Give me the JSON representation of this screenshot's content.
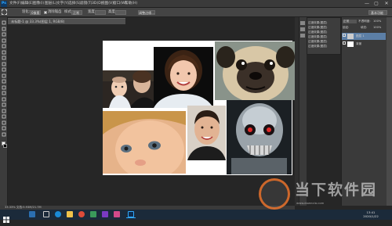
{
  "menubar": {
    "app_icon": "Ps",
    "items": [
      "文件(F)",
      "编辑(E)",
      "图像(I)",
      "图层(L)",
      "文字(Y)",
      "选择(S)",
      "滤镜(T)",
      "3D(D)",
      "视图(V)",
      "窗口(W)",
      "帮助(H)"
    ],
    "window_controls": [
      "—",
      "▢",
      "✕"
    ]
  },
  "options_bar": {
    "feather_label": "羽化:",
    "feather_value": "0像素",
    "anti_alias_label": "消除锯齿",
    "style_label": "样式:",
    "style_value": "正常",
    "width_label": "宽度:",
    "height_label": "高度:",
    "refine_button": "调整边缘...",
    "workspace_select": "基本功能"
  },
  "document": {
    "tab_title": "未标题-1 @ 33.3%(图层 1, RGB/8)",
    "status_text": "33.33%    文档:5.93M/21.7M"
  },
  "actions_panel": {
    "rows": [
      "过渡效果(图层)",
      "过渡效果(图层)",
      "过渡效果(图层)",
      "过渡效果(图层)",
      "过渡效果(图层)",
      "过渡效果(图层)"
    ]
  },
  "layers_panel": {
    "blend_mode": "正常",
    "opacity_label": "不透明度:",
    "opacity_value": "100%",
    "lock_label": "锁定:",
    "fill_label": "填充:",
    "fill_value": "100%",
    "layers": [
      "图层 1",
      "背景"
    ]
  },
  "taskbar": {
    "time": "13:41",
    "date": "2020/1/22"
  },
  "watermark": {
    "title": "当下软件园",
    "subtitle": "www.downxia.com"
  },
  "colors": {
    "menubar_bg": "#3a3a3a",
    "workspace_bg": "#262626",
    "canvas_bg": "#ffffff",
    "taskbar_bg": "#1b2a3a",
    "accent": "#31a8ff"
  },
  "icons": [
    "photoshop-icon",
    "start-icon",
    "search-icon",
    "taskview-icon",
    "edge-icon",
    "explorer-icon",
    "chrome-icon",
    "ps-taskbar-icon"
  ]
}
